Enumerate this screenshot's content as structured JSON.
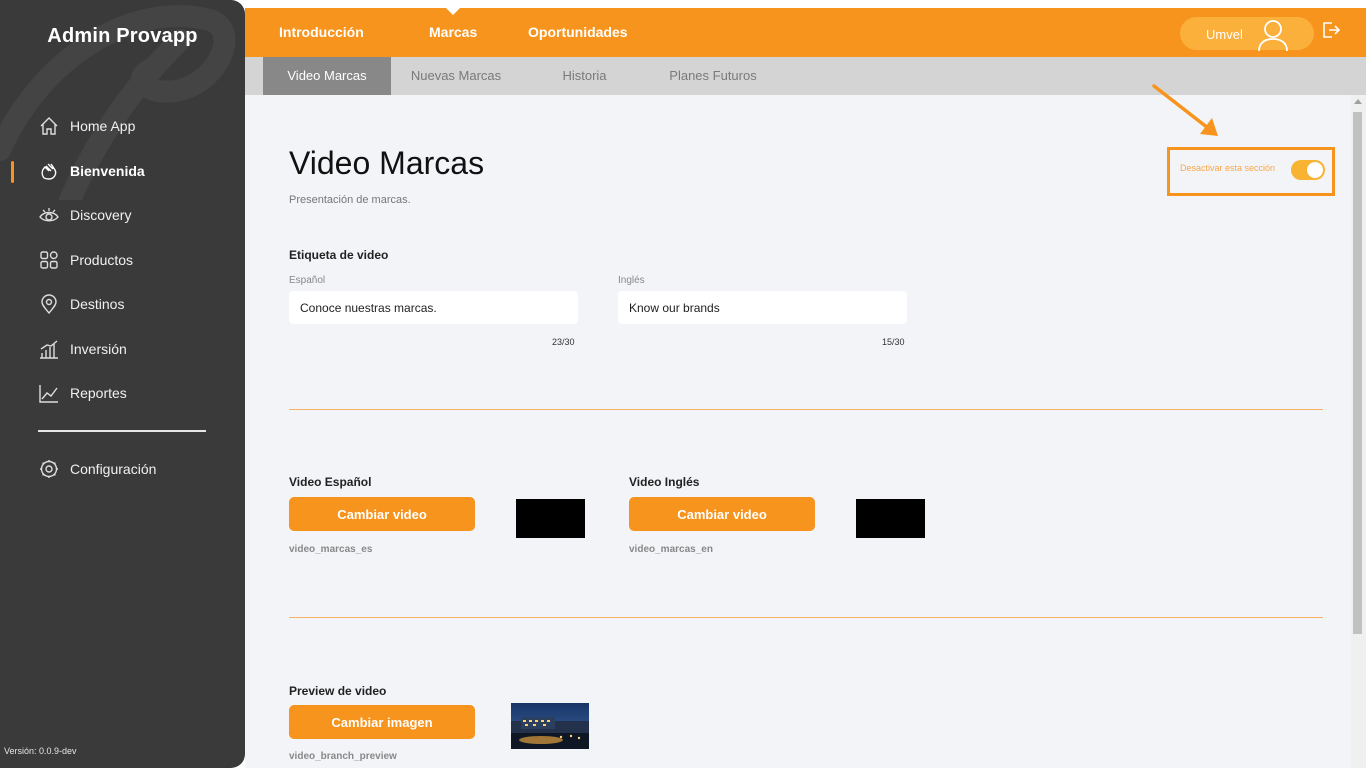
{
  "app": {
    "title": "Admin Provapp",
    "version": "Versión: 0.0.9-dev"
  },
  "sidebar": {
    "items": [
      {
        "label": "Home App",
        "icon": "home-icon",
        "active": false
      },
      {
        "label": "Bienvenida",
        "icon": "waving-hand-icon",
        "active": true
      },
      {
        "label": "Discovery",
        "icon": "eye-icon",
        "active": false
      },
      {
        "label": "Productos",
        "icon": "grid-icon",
        "active": false
      },
      {
        "label": "Destinos",
        "icon": "location-pin-icon",
        "active": false
      },
      {
        "label": "Inversión",
        "icon": "bar-chart-icon",
        "active": false
      },
      {
        "label": "Reportes",
        "icon": "line-chart-icon",
        "active": false
      }
    ],
    "config": {
      "label": "Configuración",
      "icon": "gear-icon"
    }
  },
  "topbar": {
    "tabs": [
      {
        "label": "Introducción",
        "active": false
      },
      {
        "label": "Marcas",
        "active": true
      },
      {
        "label": "Oportunidades",
        "active": false
      }
    ],
    "user": {
      "name": "Umvel",
      "icon": "user-icon"
    },
    "logout_icon": "logout-icon"
  },
  "subtabs": [
    {
      "label": "Video Marcas",
      "active": true
    },
    {
      "label": "Nuevas Marcas",
      "active": false
    },
    {
      "label": "Historia",
      "active": false
    },
    {
      "label": "Planes Futuros",
      "active": false
    }
  ],
  "page": {
    "title": "Video Marcas",
    "subtitle": "Presentación de marcas.",
    "toggle": {
      "label": "Desactivar esta sección",
      "on": true
    }
  },
  "video_label": {
    "heading": "Etiqueta de video",
    "es": {
      "label": "Español",
      "value": "Conoce nuestras marcas.",
      "counter": "23/30"
    },
    "en": {
      "label": "Inglés",
      "value": "Know our brands",
      "counter": "15/30"
    }
  },
  "videos": {
    "es": {
      "heading": "Video Español",
      "button": "Cambiar video",
      "filename": "video_marcas_es"
    },
    "en": {
      "heading": "Video Inglés",
      "button": "Cambiar video",
      "filename": "video_marcas_en"
    }
  },
  "preview": {
    "heading": "Preview de video",
    "button": "Cambiar imagen",
    "filename": "video_branch_preview"
  },
  "colors": {
    "accent": "#f7941d",
    "sidebar": "#3a3a3a",
    "content_bg": "#f3f4f8",
    "subbar": "#d4d4d4"
  }
}
